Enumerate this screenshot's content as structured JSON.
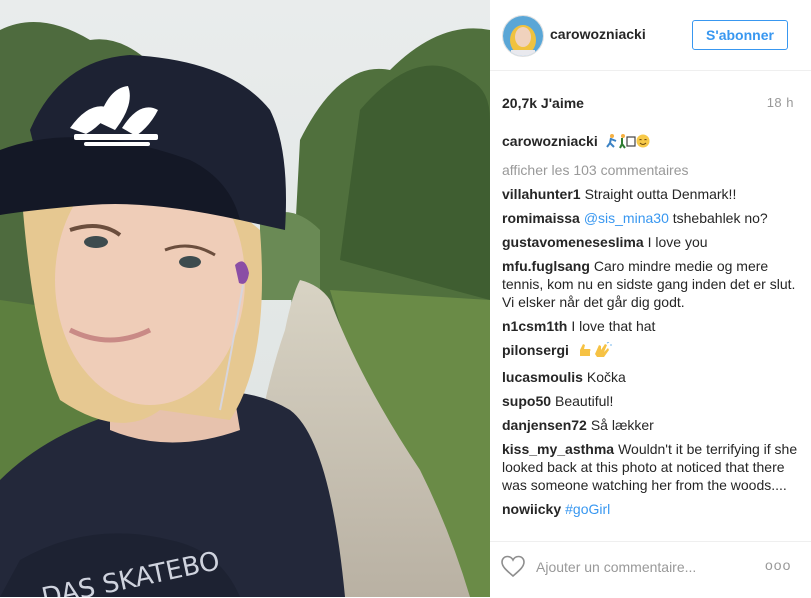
{
  "post": {
    "username": "carowozniacki",
    "follow_label": "S'abonner",
    "likes": "20,7k J'aime",
    "time_ago": "18 h",
    "caption_user": "carowozniacki",
    "load_more": "afficher les 103 commentaires",
    "comments": [
      {
        "user": "villahunter1",
        "text": "Straight outta Denmark!!"
      },
      {
        "user": "romimaissa",
        "mention": "@sis_mina30",
        "text": " tshebahlek no?"
      },
      {
        "user": "gustavomenesesIima",
        "text": "I love you"
      },
      {
        "user": "mfu.fuglsang",
        "text": "Caro mindre medie og mere tennis, kom nu en sidste gang inden det er slut. Vi elsker når det går dig godt."
      },
      {
        "user": "n1csm1th",
        "text": "I love that hat"
      },
      {
        "user": "pilonsergi",
        "text": ""
      },
      {
        "user": "lucasmoulis",
        "text": "Kočka"
      },
      {
        "user": "supo50",
        "text": "Beautiful!"
      },
      {
        "user": "danjensen72",
        "text": "Så lækker"
      },
      {
        "user": "kiss_my_asthma",
        "text": "Wouldn't it be terrifying if she looked back at this photo at noticed that there was someone watching her from the woods...."
      },
      {
        "user": "nowiicky",
        "mention": "#goGirl",
        "text": ""
      }
    ],
    "add_comment_placeholder": "Ajouter un commentaire...",
    "more_label": "ooo"
  },
  "icons": {
    "heart": "heart-icon",
    "avatar": "avatar",
    "caption_emoji": "runner-emoji",
    "clap_emoji": "clap-emoji"
  },
  "colors": {
    "accent": "#3897f0",
    "muted": "#999999",
    "text": "#262626",
    "divider": "#efefef"
  }
}
